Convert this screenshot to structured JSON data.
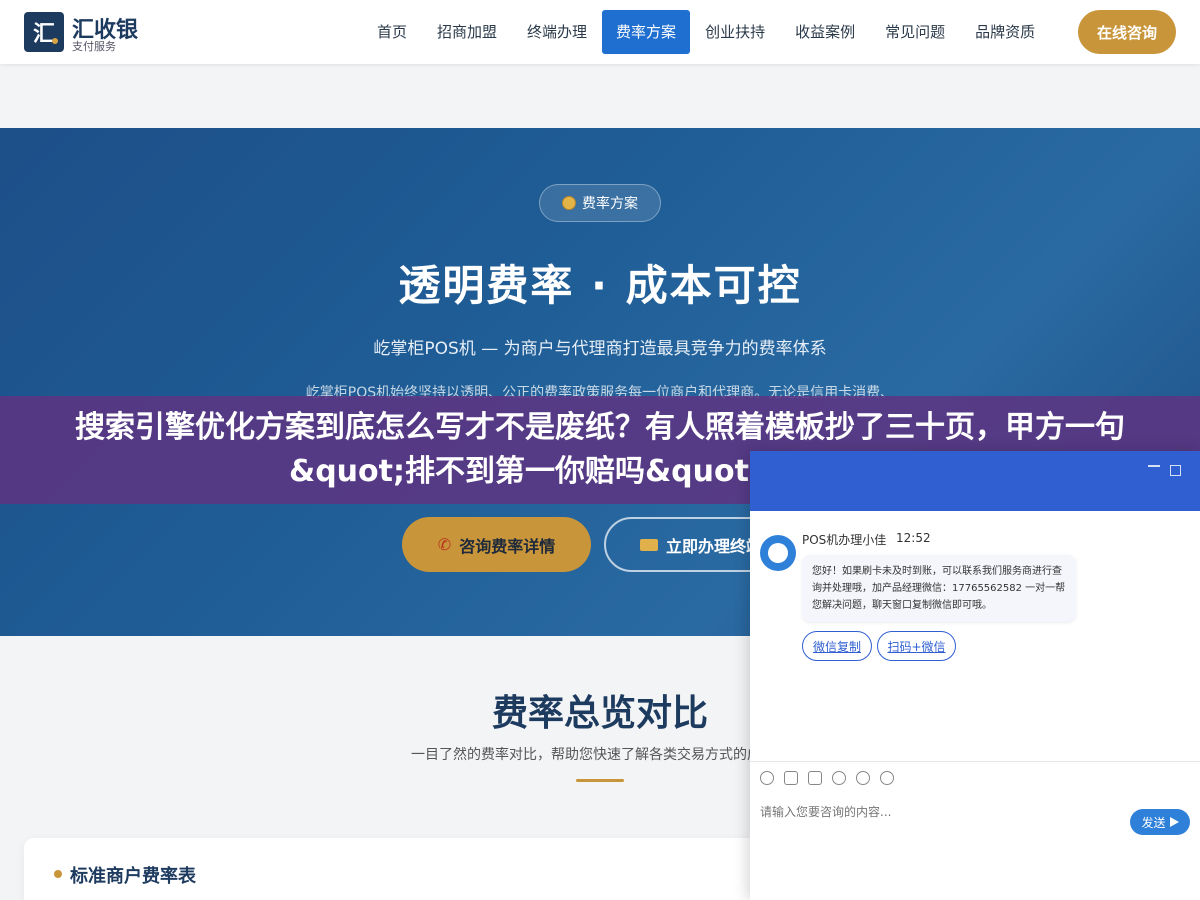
{
  "header": {
    "logo_mark": "汇",
    "logo_title": "汇收银",
    "logo_subtitle": "支付服务",
    "nav": [
      "首页",
      "招商加盟",
      "终端办理",
      "费率方案",
      "创业扶持",
      "收益案例",
      "常见问题",
      "品牌资质"
    ],
    "active_nav": "费率方案",
    "cta": "在线咨询"
  },
  "hero": {
    "badge": "费率方案",
    "title": "透明费率 · 成本可控",
    "subtitle": "屹掌柜POS机 — 为商户与代理商打造最具竞争力的费率体系",
    "description": "屹掌柜POS机始终坚持以透明、公正的费率政策服务每一位商户和代理商。无论是信用卡消费、",
    "button_primary": "咨询费率详情",
    "button_secondary": "立即办理终端"
  },
  "overlay": {
    "headline": "搜索引擎优化方案到底怎么写才不是废纸？有人照着模板抄了三十页，甲方一句&quot;排不到第一你赔吗&quot;就全盘推翻"
  },
  "comparison": {
    "title": "费率总览对比",
    "subtitle": "一目了然的费率对比，帮助您快速了解各类交易方式的成本构",
    "card_title": "标准商户费率表"
  },
  "chat": {
    "agent_name": "POS机办理小佳",
    "time": "12:52",
    "message": "您好！如果刷卡未及时到账，可以联系我们服务商进行查询并处理哦，加产品经理微信：17765562582 一对一帮您解决问题，聊天窗口复制微信即可哦。",
    "chip_copy": "微信复制",
    "chip_scan": "扫码+微信",
    "input_placeholder": "请输入您要咨询的内容...",
    "send": "发送"
  },
  "colors": {
    "brand_blue": "#1d3a5f",
    "nav_active": "#1f6fd1",
    "gold": "#c9953a",
    "overlay_purple": "#5c3482",
    "chat_blue": "#2f5fd1"
  }
}
